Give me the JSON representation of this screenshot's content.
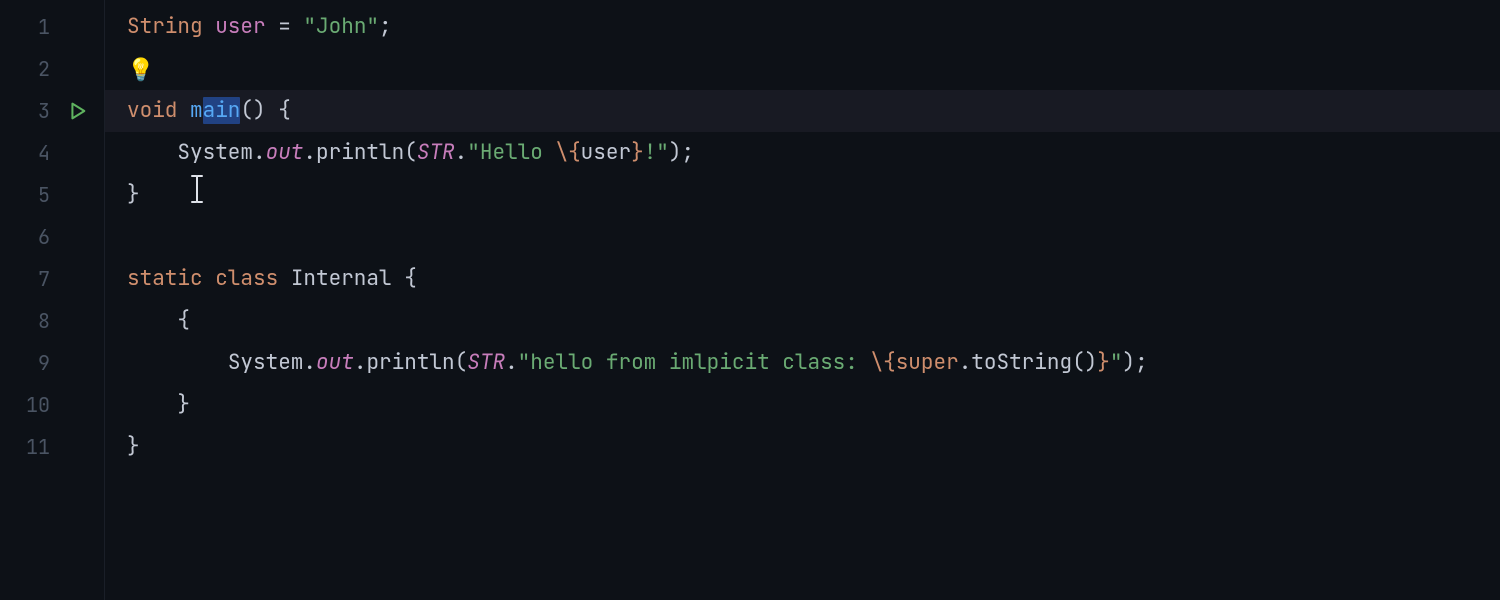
{
  "editor": {
    "line_count": 11,
    "current_line": 3,
    "caret_line": 3,
    "lines": {
      "1": {
        "num": "1"
      },
      "2": {
        "num": "2"
      },
      "3": {
        "num": "3",
        "run": true
      },
      "4": {
        "num": "4"
      },
      "5": {
        "num": "5"
      },
      "6": {
        "num": "6"
      },
      "7": {
        "num": "7"
      },
      "8": {
        "num": "8"
      },
      "9": {
        "num": "9"
      },
      "10": {
        "num": "10"
      },
      "11": {
        "num": "11"
      }
    },
    "code": {
      "l1": {
        "type": "String ",
        "ident": "user",
        "rest1": " = ",
        "str": "\"John\"",
        "semi": ";"
      },
      "l3": {
        "kw": "void ",
        "fn_pre_sel": "m",
        "fn_sel": "ain",
        "paren": "() ",
        "brace": "{"
      },
      "l4": {
        "indent": "    ",
        "sys": "System.",
        "out": "out",
        "dot": ".",
        "println": "println",
        "open": "(",
        "str_tmpl": "STR",
        "dot2": ".",
        "str1": "\"Hello ",
        "interp_open": "\\{",
        "interp_ident": "user",
        "interp_close": "}",
        "str2": "!\"",
        "close": ");"
      },
      "l5": {
        "brace": "}"
      },
      "l7": {
        "kw1": "static ",
        "kw2": "class ",
        "name": "Internal ",
        "brace": "{"
      },
      "l8": {
        "indent": "    ",
        "brace": "{"
      },
      "l9": {
        "indent": "        ",
        "sys": "System.",
        "out": "out",
        "dot": ".",
        "println": "println",
        "open": "(",
        "str_tmpl": "STR",
        "dot2": ".",
        "str1": "\"hello from imlpicit class: ",
        "interp_open": "\\{",
        "interp_kw": "super",
        "interp_rest": ".toString()",
        "interp_close": "}",
        "str2": "\"",
        "close": ");"
      },
      "l10": {
        "indent": "    ",
        "brace": "}"
      },
      "l11": {
        "brace": "}"
      }
    },
    "icons": {
      "bulb": "💡"
    }
  }
}
